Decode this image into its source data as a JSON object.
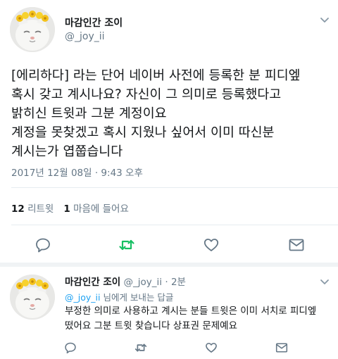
{
  "main_tweet": {
    "display_name": "마감인간 조이",
    "handle": "@_joy_ii",
    "text_lines": [
      "[에리하다] 라는 단어 네이버 사전에 등록한 분 피디엪",
      "혹시 갖고 계시나요? 자신이 그 의미로 등록했다고",
      "밝히신 트윗과 그분 계정이요",
      "계정을 못찾겠고 혹시 지웠나 싶어서 이미 따신분",
      "계시는가 엽쭙습니다"
    ],
    "timestamp": "2017년 12월 08일 · 9:43 오후",
    "retweet_count": "12",
    "retweet_label": "리트윗",
    "like_count": "1",
    "like_label": "마음에 들어요"
  },
  "reply_tweet": {
    "display_name": "마감인간 조이",
    "handle": "@_joy_ii",
    "separator": "·",
    "time_ago": "2분",
    "replying_handle": "@_joy_ii",
    "replying_suffix": " 님에게 보내는 답글",
    "text_lines": [
      "부정한 의미로 사용하고 계시는 분들 트윗은 이미 서치로 피디엪",
      "떴어요 그분 트윗 찾습니다 상표권 문제예요"
    ]
  },
  "icons": {
    "reply": "reply-icon",
    "retweet": "retweet-icon",
    "like": "heart-icon",
    "dm": "mail-icon",
    "menu": "chevron-down-icon"
  },
  "colors": {
    "retweet_active": "#17bf63",
    "link": "#1da1f2",
    "secondary_text": "#657786",
    "icon_gray": "#657786"
  }
}
